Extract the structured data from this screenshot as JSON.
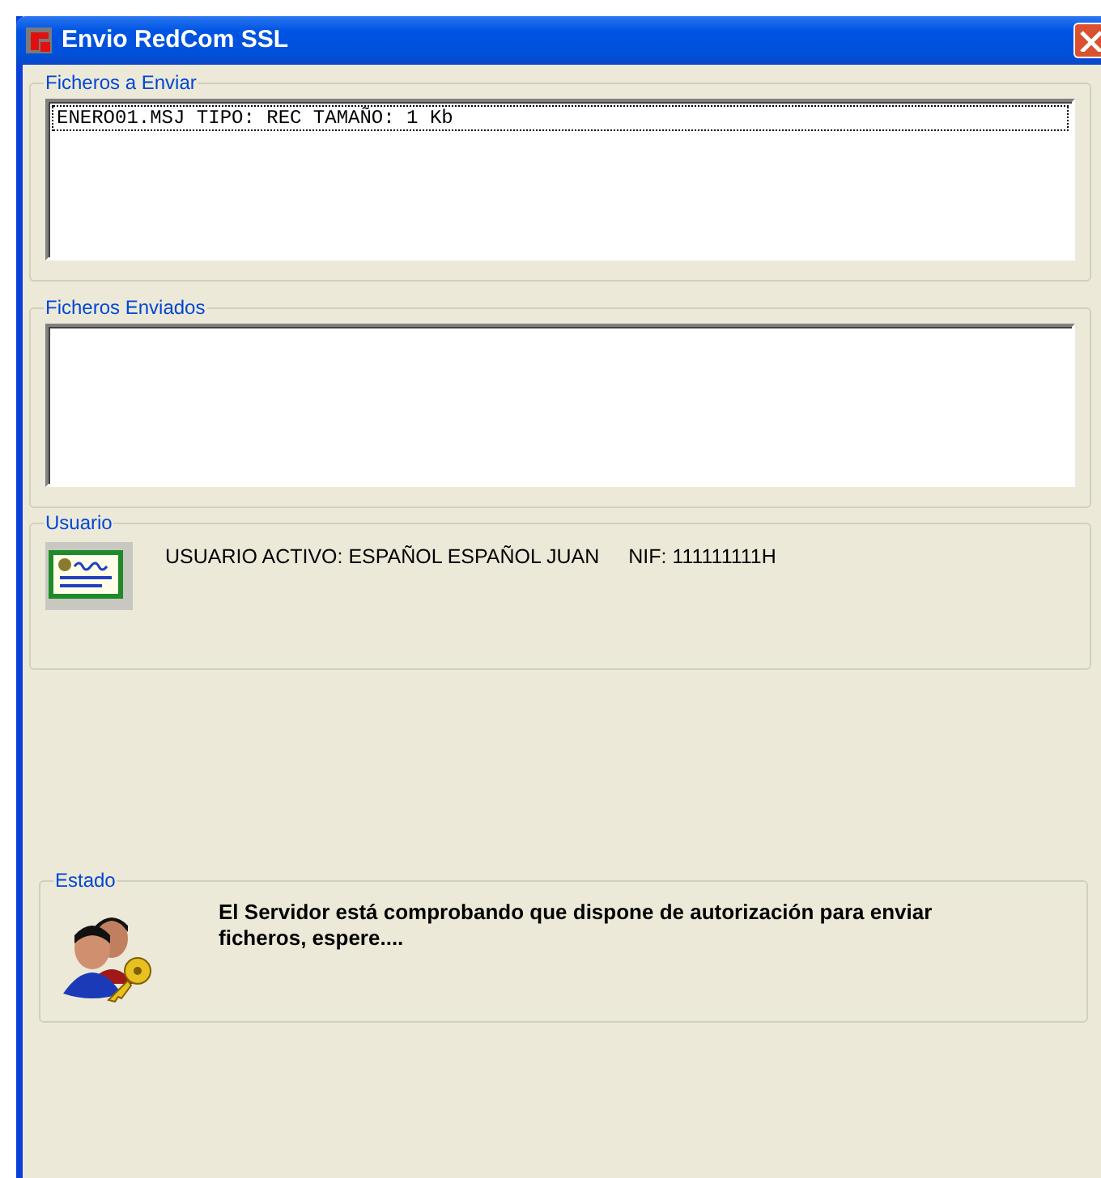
{
  "window": {
    "title": "Envio RedCom SSL"
  },
  "files_to_send": {
    "title": "Ficheros a Enviar",
    "items": [
      {
        "text": "ENERO01.MSJ TIPO: REC TAMAÑO: 1 Kb",
        "selected": true
      }
    ]
  },
  "files_sent": {
    "title": "Ficheros Enviados"
  },
  "user": {
    "title": "Usuario",
    "active_user": "USUARIO ACTIVO: ESPAÑOL ESPAÑOL JUAN",
    "nif": "NIF: 111111111H"
  },
  "status": {
    "title": "Estado",
    "message": "El Servidor está comprobando que dispone de autorización para enviar ficheros, espere...."
  }
}
